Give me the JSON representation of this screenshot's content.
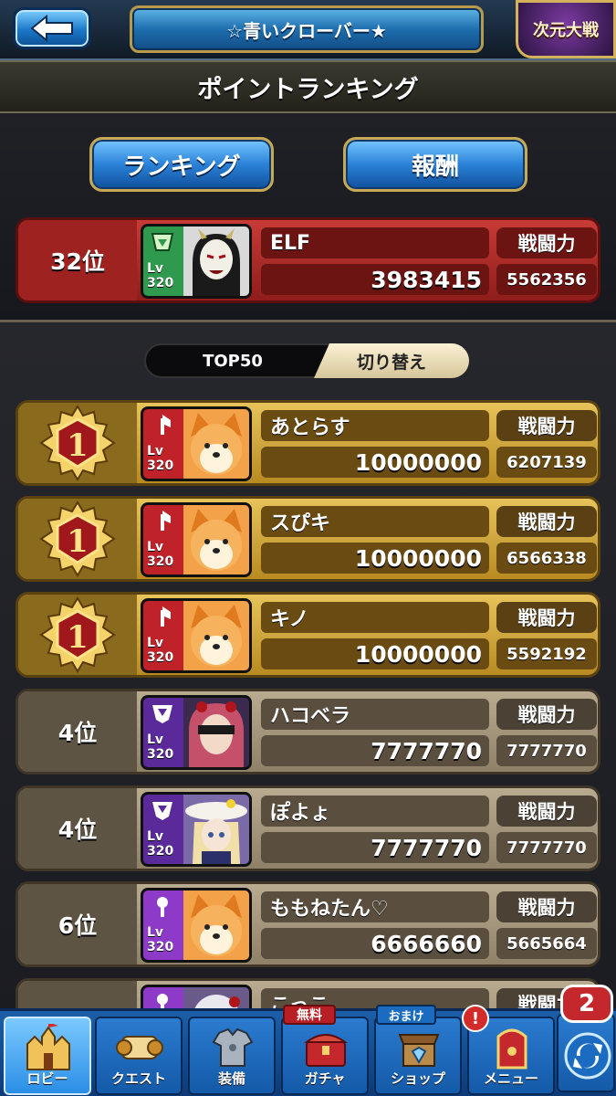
{
  "header": {
    "title": "☆青いクローバー★",
    "badge": "次元大戦"
  },
  "page_title": "ポイントランキング",
  "tabs": {
    "ranking": "ランキング",
    "reward": "報酬"
  },
  "power_label": "戦闘力",
  "level_prefix": "Lv",
  "self_row": {
    "rank": "32位",
    "level": "320",
    "name": "ELF",
    "score": "3983415",
    "power": "5562356"
  },
  "toggle": {
    "label": "TOP50",
    "button": "切り替え"
  },
  "rows": [
    {
      "rank": "1",
      "level": "320",
      "name": "あとらす",
      "score": "10000000",
      "power": "6207139"
    },
    {
      "rank": "1",
      "level": "320",
      "name": "スぴキ",
      "score": "10000000",
      "power": "6566338"
    },
    {
      "rank": "1",
      "level": "320",
      "name": "キノ",
      "score": "10000000",
      "power": "5592192"
    },
    {
      "rank": "4位",
      "level": "320",
      "name": "ハコベラ",
      "score": "7777770",
      "power": "7777770"
    },
    {
      "rank": "4位",
      "level": "320",
      "name": "ぽよょ",
      "score": "7777770",
      "power": "7777770"
    },
    {
      "rank": "6位",
      "level": "320",
      "name": "ももねたん♡",
      "score": "6666660",
      "power": "5665664"
    }
  ],
  "partial_row": {
    "name": "こっこ",
    "power_label": "戦闘力"
  },
  "bottom_nav": [
    {
      "label": "ロビー",
      "icon": "castle-icon"
    },
    {
      "label": "クエスト",
      "icon": "scroll-icon"
    },
    {
      "label": "装備",
      "icon": "armor-icon"
    },
    {
      "label": "ガチャ",
      "icon": "treasure-icon"
    },
    {
      "label": "ショップ",
      "icon": "shop-icon"
    },
    {
      "label": "メニュー",
      "icon": "door-icon"
    }
  ],
  "tags": {
    "free": "無料",
    "bonus": "おまけ",
    "alert": "!"
  },
  "refresh_count": "2",
  "colors": {
    "accent_blue": "#2a82d8",
    "gold": "#e7c35a",
    "self_red": "#c83b36"
  }
}
